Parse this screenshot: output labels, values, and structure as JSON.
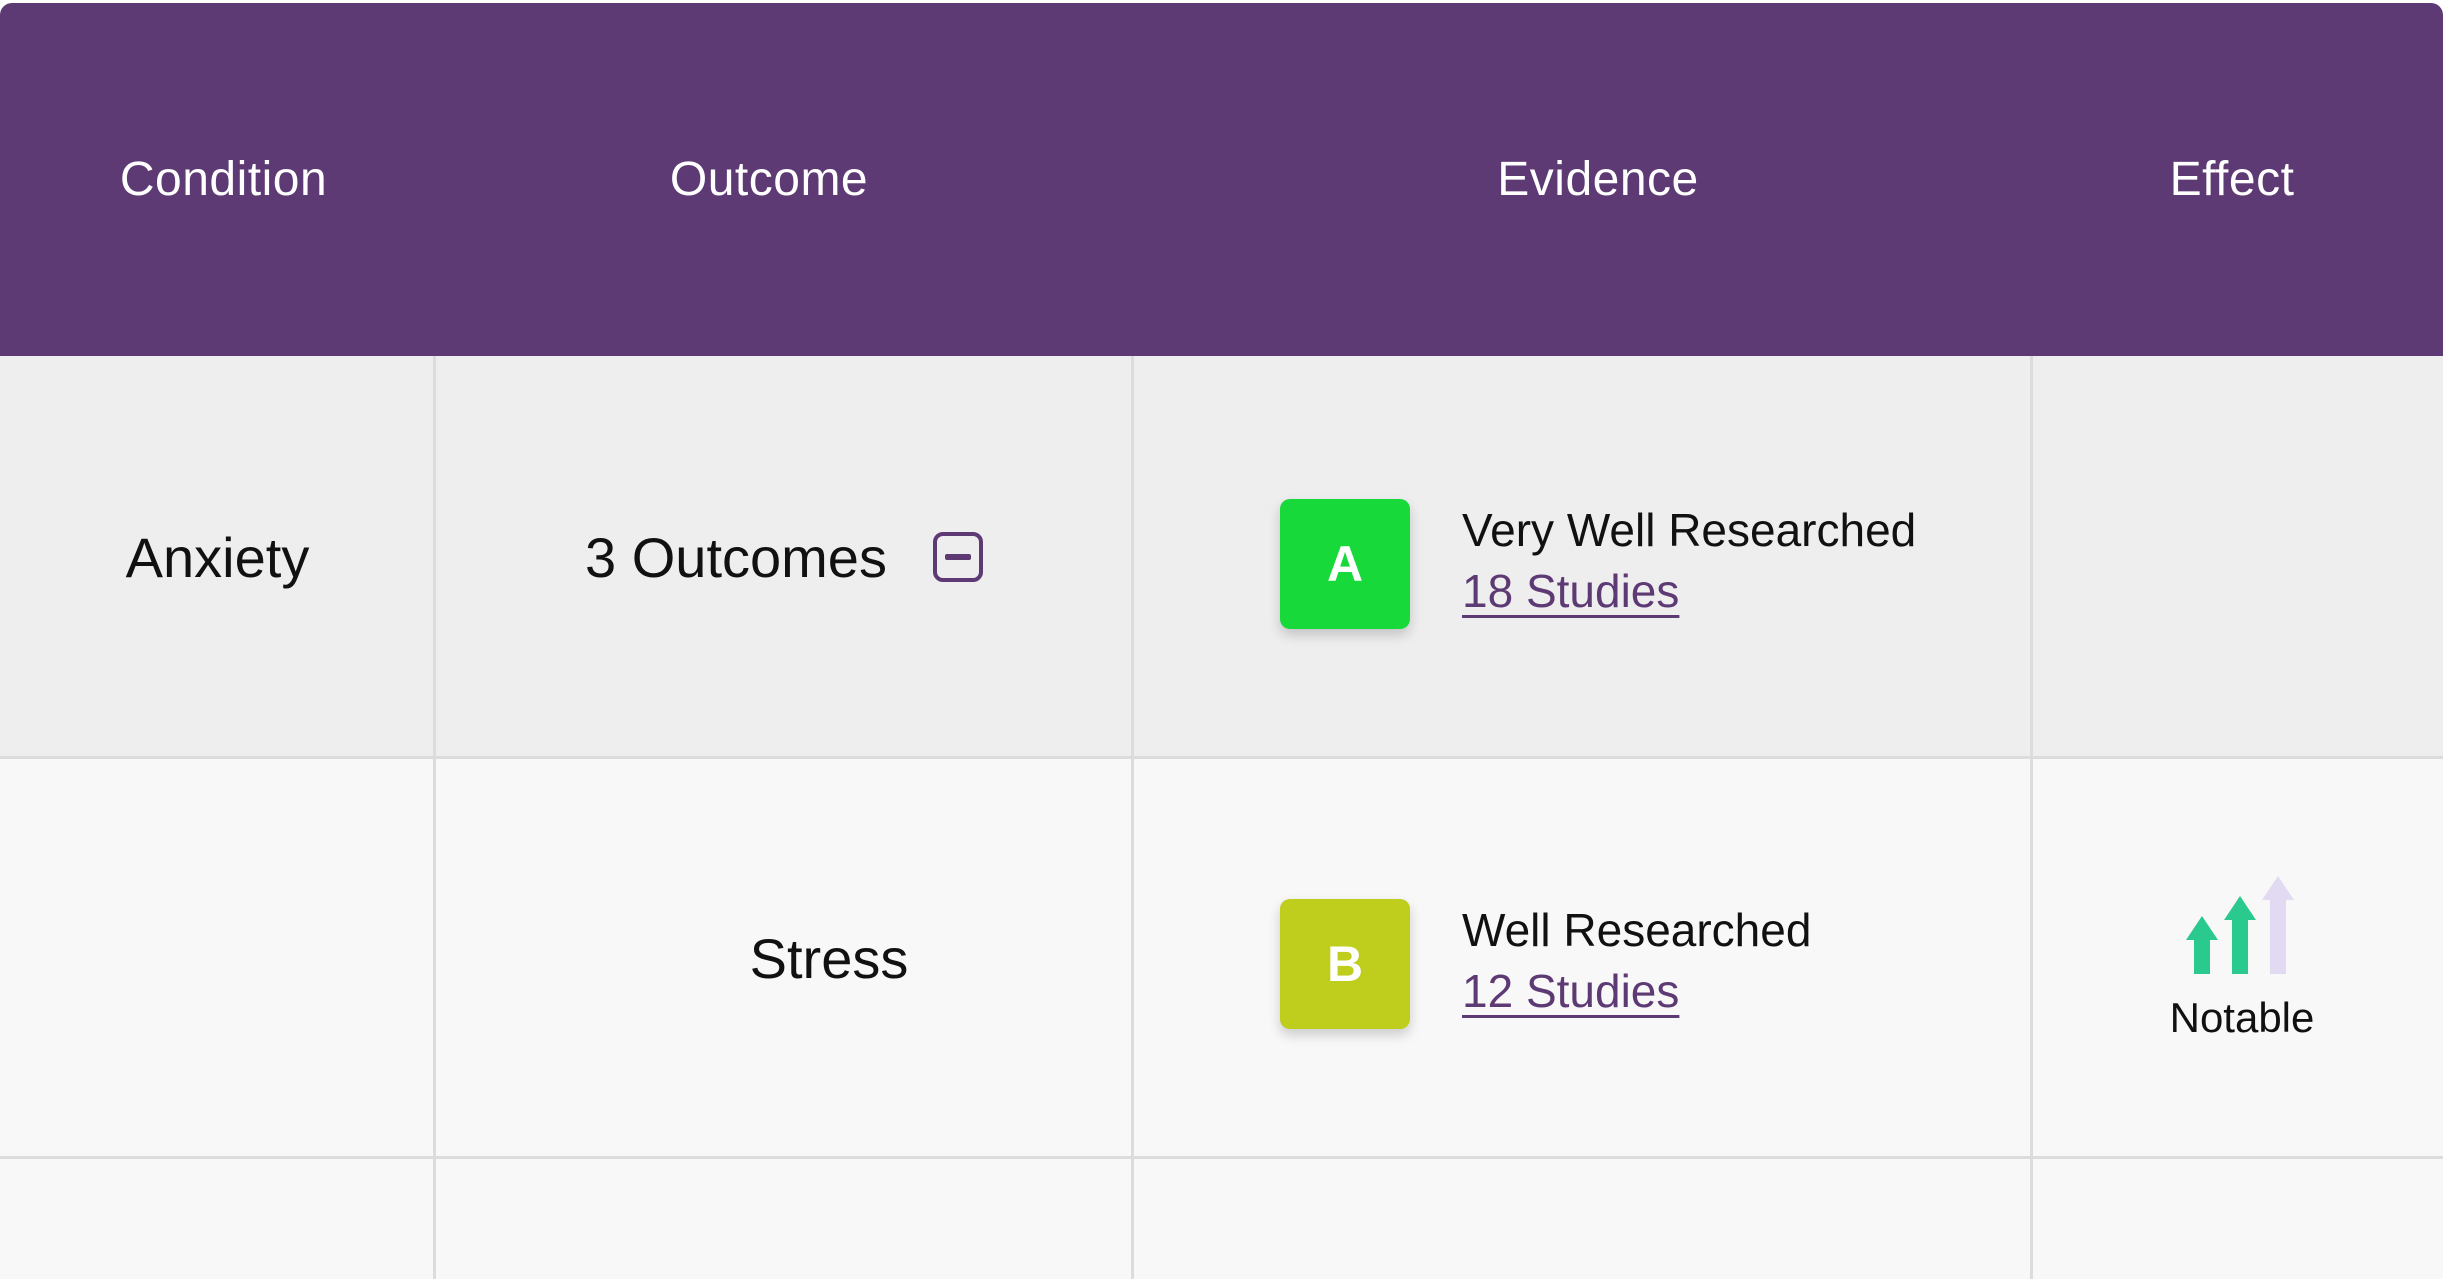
{
  "header": {
    "condition": "Condition",
    "outcome": "Outcome",
    "evidence": "Evidence",
    "effect": "Effect"
  },
  "rows": [
    {
      "condition": "Anxiety",
      "outcome": "3 Outcomes",
      "grade": "A",
      "grade_color": "#17da3a",
      "evidence_label": "Very Well Researched",
      "studies": "18 Studies"
    },
    {
      "condition": "",
      "outcome": "Stress",
      "grade": "B",
      "grade_color": "#bfcd1c",
      "evidence_label": "Well Researched",
      "studies": "12 Studies",
      "effect": "Notable",
      "effect_level": 2,
      "effect_max": 3
    }
  ],
  "colors": {
    "header_bg": "#5e3a74",
    "link": "#5e3a74",
    "arrow_active": "#2ac98e",
    "arrow_inactive": "#e2daf3"
  },
  "icons": {
    "collapse": "minus-square-icon",
    "effect": "effect-arrows-icon"
  }
}
